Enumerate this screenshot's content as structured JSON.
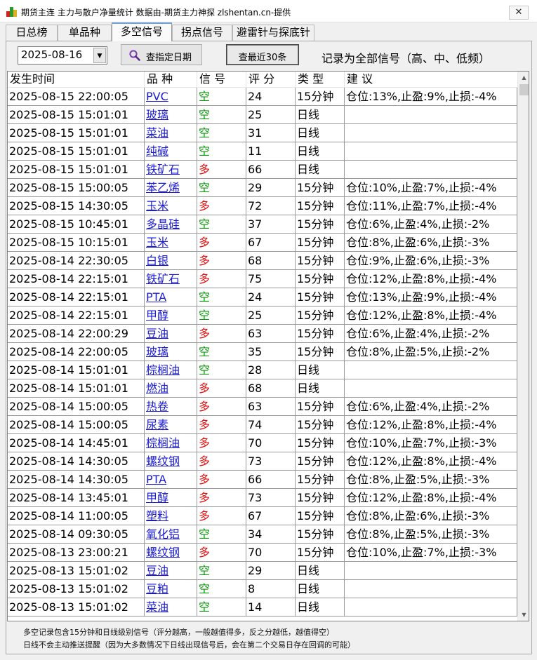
{
  "window": {
    "title": "期货主连 主力与散户净量统计 数据由-期货主力神探 zlshentan.cn-提供",
    "close_glyph": "✕"
  },
  "tabs": [
    {
      "label": "日总榜",
      "active": false
    },
    {
      "label": "单品种",
      "active": false
    },
    {
      "label": "多空信号",
      "active": true
    },
    {
      "label": "拐点信号",
      "active": false
    },
    {
      "label": "避雷针与探底针",
      "active": false
    }
  ],
  "toolbar": {
    "date_value": "2025-08-16",
    "query_date_label": "查指定日期",
    "recent_label": "查最近30条",
    "record_note": "记录为全部信号（高、中、低频）"
  },
  "icons": {
    "app": "app-logo-icon",
    "query": "magnifier-icon",
    "dropdown": "chevron-down-icon"
  },
  "colors": {
    "long": "#e01010",
    "short": "#0a9a0a",
    "link": "#1a1ad6"
  },
  "table": {
    "columns": [
      "发生时间",
      "品 种",
      "信 号",
      "评 分",
      "类 型",
      "建 议"
    ],
    "rows": [
      [
        "2025-08-15 22:00:05",
        "PVC",
        "空",
        "24",
        "15分钟",
        "仓位:13%,止盈:9%,止损:-4%"
      ],
      [
        "2025-08-15 15:01:01",
        "玻璃",
        "空",
        "25",
        "日线",
        ""
      ],
      [
        "2025-08-15 15:01:01",
        "菜油",
        "空",
        "31",
        "日线",
        ""
      ],
      [
        "2025-08-15 15:01:01",
        "纯碱",
        "空",
        "11",
        "日线",
        ""
      ],
      [
        "2025-08-15 15:01:01",
        "铁矿石",
        "多",
        "66",
        "日线",
        ""
      ],
      [
        "2025-08-15 15:00:05",
        "苯乙烯",
        "空",
        "29",
        "15分钟",
        "仓位:10%,止盈:7%,止损:-4%"
      ],
      [
        "2025-08-15 14:30:05",
        "玉米",
        "多",
        "72",
        "15分钟",
        "仓位:11%,止盈:7%,止损:-4%"
      ],
      [
        "2025-08-15 10:45:01",
        "多晶硅",
        "空",
        "37",
        "15分钟",
        "仓位:6%,止盈:4%,止损:-2%"
      ],
      [
        "2025-08-15 10:15:01",
        "玉米",
        "多",
        "67",
        "15分钟",
        "仓位:8%,止盈:6%,止损:-3%"
      ],
      [
        "2025-08-14 22:30:05",
        "白银",
        "多",
        "68",
        "15分钟",
        "仓位:9%,止盈:6%,止损:-3%"
      ],
      [
        "2025-08-14 22:15:01",
        "铁矿石",
        "多",
        "75",
        "15分钟",
        "仓位:12%,止盈:8%,止损:-4%"
      ],
      [
        "2025-08-14 22:15:01",
        "PTA",
        "空",
        "24",
        "15分钟",
        "仓位:13%,止盈:9%,止损:-4%"
      ],
      [
        "2025-08-14 22:15:01",
        "甲醇",
        "空",
        "25",
        "15分钟",
        "仓位:12%,止盈:8%,止损:-4%"
      ],
      [
        "2025-08-14 22:00:29",
        "豆油",
        "多",
        "63",
        "15分钟",
        "仓位:6%,止盈:4%,止损:-2%"
      ],
      [
        "2025-08-14 22:00:05",
        "玻璃",
        "空",
        "35",
        "15分钟",
        "仓位:8%,止盈:5%,止损:-2%"
      ],
      [
        "2025-08-14 15:01:01",
        "棕榈油",
        "空",
        "28",
        "日线",
        ""
      ],
      [
        "2025-08-14 15:01:01",
        "燃油",
        "多",
        "68",
        "日线",
        ""
      ],
      [
        "2025-08-14 15:00:05",
        "热卷",
        "多",
        "63",
        "15分钟",
        "仓位:6%,止盈:4%,止损:-2%"
      ],
      [
        "2025-08-14 15:00:05",
        "尿素",
        "多",
        "74",
        "15分钟",
        "仓位:12%,止盈:8%,止损:-4%"
      ],
      [
        "2025-08-14 14:45:01",
        "棕榈油",
        "多",
        "70",
        "15分钟",
        "仓位:10%,止盈:7%,止损:-3%"
      ],
      [
        "2025-08-14 14:30:05",
        "螺纹钢",
        "多",
        "73",
        "15分钟",
        "仓位:12%,止盈:8%,止损:-4%"
      ],
      [
        "2025-08-14 14:30:05",
        "PTA",
        "多",
        "66",
        "15分钟",
        "仓位:8%,止盈:5%,止损:-3%"
      ],
      [
        "2025-08-14 13:45:01",
        "甲醇",
        "多",
        "73",
        "15分钟",
        "仓位:12%,止盈:8%,止损:-4%"
      ],
      [
        "2025-08-14 11:00:05",
        "塑料",
        "多",
        "67",
        "15分钟",
        "仓位:8%,止盈:6%,止损:-3%"
      ],
      [
        "2025-08-14 09:30:05",
        "氧化铝",
        "空",
        "34",
        "15分钟",
        "仓位:8%,止盈:5%,止损:-3%"
      ],
      [
        "2025-08-13 23:00:21",
        "螺纹钢",
        "多",
        "70",
        "15分钟",
        "仓位:10%,止盈:7%,止损:-3%"
      ],
      [
        "2025-08-13 15:01:02",
        "豆油",
        "空",
        "29",
        "日线",
        ""
      ],
      [
        "2025-08-13 15:01:02",
        "豆粕",
        "空",
        "8",
        "日线",
        ""
      ],
      [
        "2025-08-13 15:01:02",
        "菜油",
        "空",
        "14",
        "日线",
        ""
      ]
    ]
  },
  "footer": {
    "line1": "多空记录包含15分钟和日线级别信号（评分越高，一般越值得多，反之分越低，越值得空）",
    "line2": "日线不会主动推送提醒（因为大多数情况下日线出现信号后，会在第二个交易日存在回调的可能）"
  }
}
